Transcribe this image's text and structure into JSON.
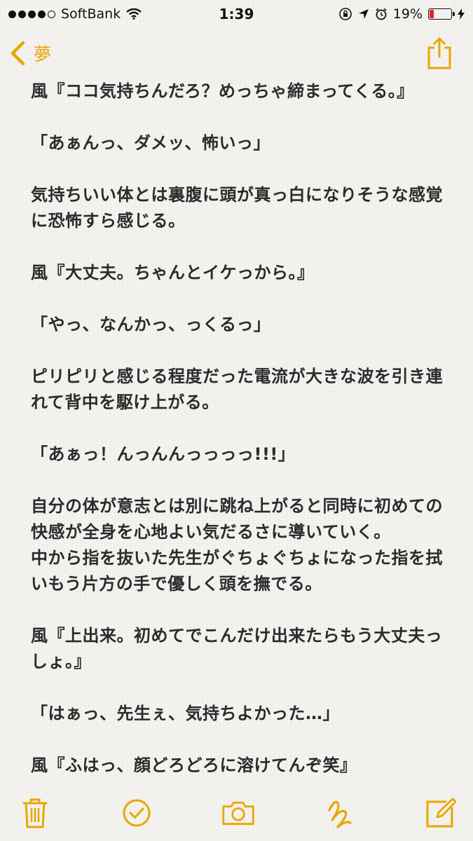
{
  "status_bar": {
    "carrier": "SoftBank",
    "time": "1:39",
    "battery_percent_label": "19%",
    "battery_level": 0.19
  },
  "nav": {
    "back_label": "夢"
  },
  "note": {
    "paragraphs": [
      "風『ココ気持ちんだろ？めっちゃ締まってくる。』",
      "「あぁんっ、ダメッ、怖いっ」",
      "気持ちいい体とは裏腹に頭が真っ白になりそうな感覚\nに恐怖すら感じる。",
      "風『大丈夫。ちゃんとイケっから。』",
      "「やっ、なんかっ、っくるっ」",
      "ピリピリと感じる程度だった電流が大きな波を引き連\nれて背中を駆け上がる。",
      "「あぁっ！んっんんっっっっ!!!」",
      "自分の体が意志とは別に跳ね上がると同時に初めての\n快感が全身を心地よい気だるさに導いていく。\n中から指を抜いた先生がぐちょぐちょになった指を拭\nいもう片方の手で優しく頭を撫でる。",
      "風『上出来。初めてでこんだけ出来たらもう大丈夫っ\nしょ。』",
      "「はぁっ、先生ぇ、気持ちよかった…」",
      "風『ふはっ、顔どろどろに溶けてんぞ笑』"
    ]
  },
  "toolbar": {
    "icons": [
      "trash-icon",
      "checklist-icon",
      "camera-icon",
      "sketch-icon",
      "compose-icon"
    ]
  },
  "colors": {
    "accent": "#e9a600",
    "text": "#2b2b2b",
    "battery_low": "#e0262b"
  }
}
